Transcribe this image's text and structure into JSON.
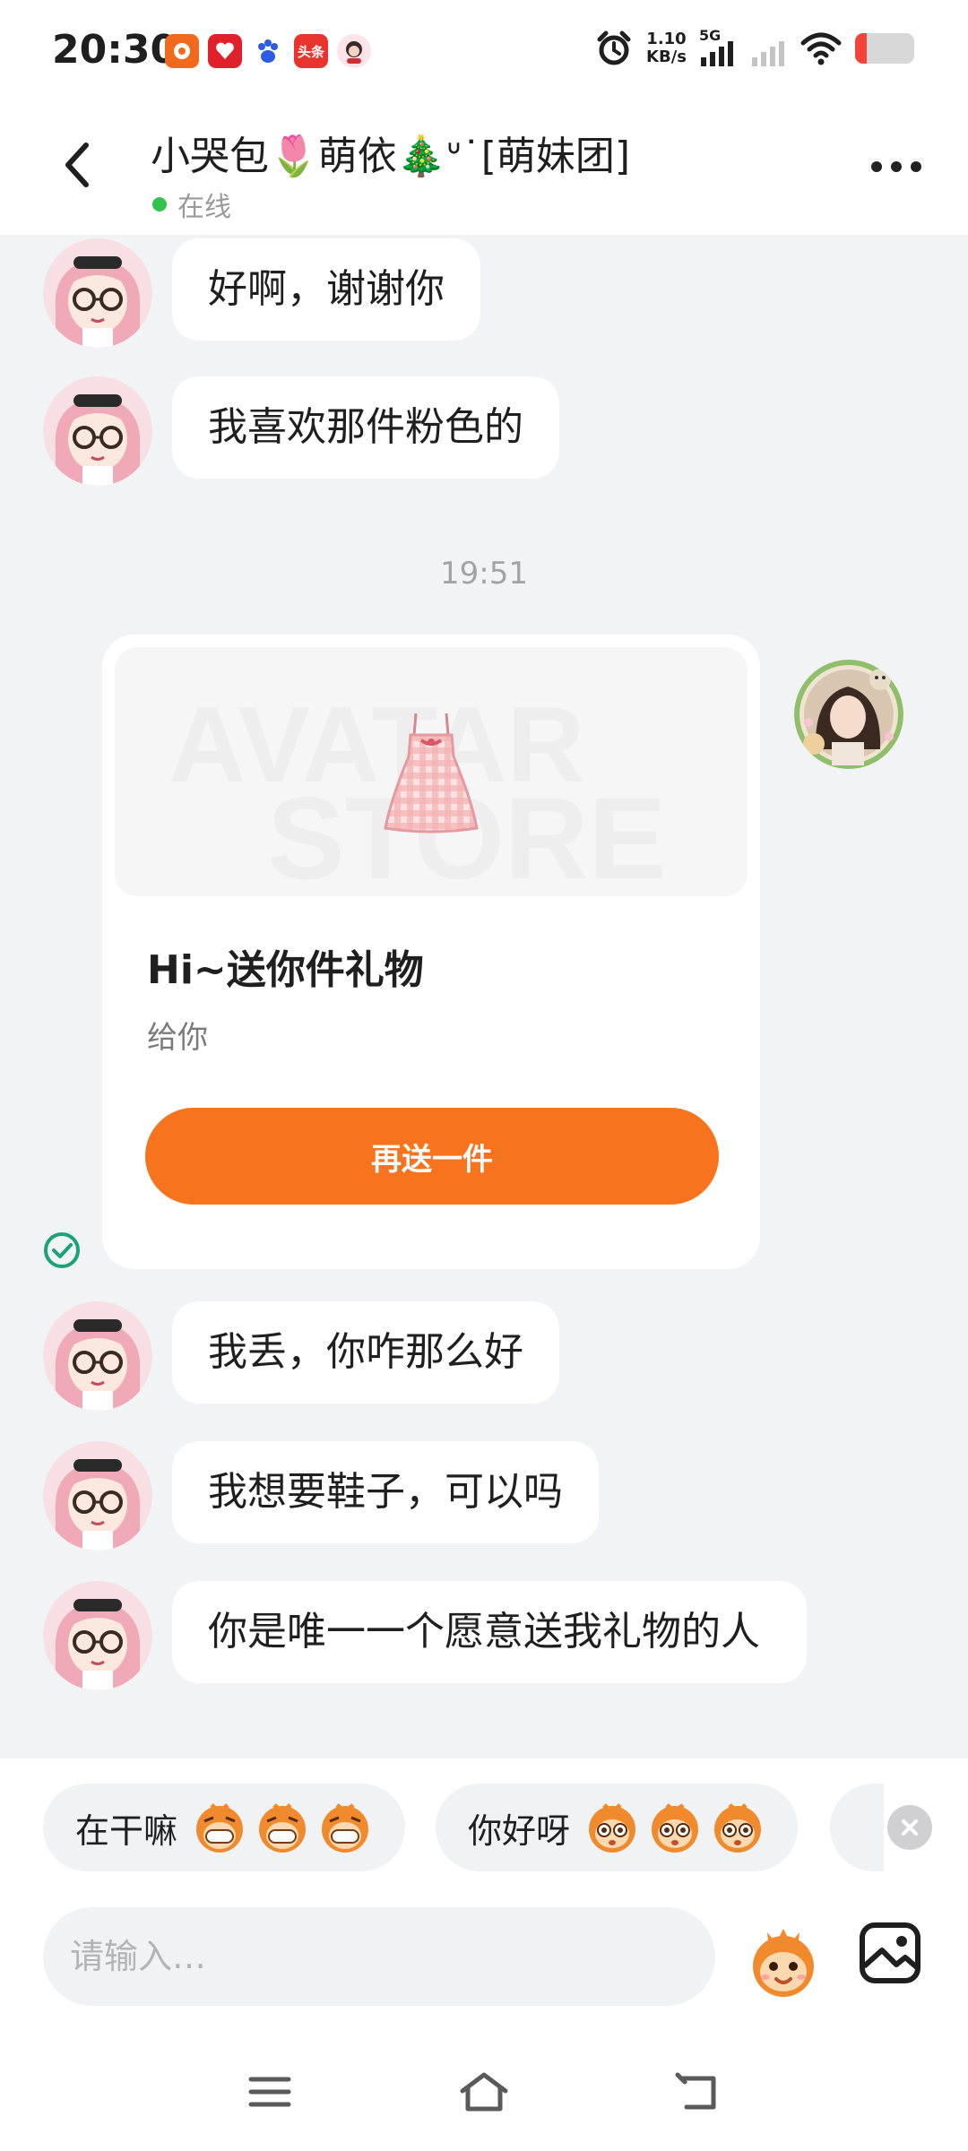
{
  "status_bar": {
    "time": "20:30",
    "app_icons": [
      "weibo-icon",
      "app-store-icon",
      "baidu-icon",
      "toutiao-icon",
      "avatar-app-icon"
    ],
    "toutiao_label": "头条",
    "net_speed_value": "1.10",
    "net_speed_unit": "KB/s",
    "network_type": "5G",
    "battery_level": 0.2
  },
  "header": {
    "title": "小哭包🌷萌依🎄ᐡ˙[萌妹团]",
    "status": "在线"
  },
  "chat": {
    "messages_top": [
      {
        "text": "好啊，谢谢你"
      },
      {
        "text": "我喜欢那件粉色的"
      }
    ],
    "time_separator": "19:51",
    "gift": {
      "watermark_top": "AVATAR",
      "watermark_bottom": "STORE",
      "title": "Hi~送你件礼物",
      "subtitle": "给你",
      "button": "再送一件"
    },
    "messages_bottom": [
      {
        "text": "我丢，你咋那么好"
      },
      {
        "text": "我想要鞋子，可以吗"
      },
      {
        "text": "你是唯一一个愿意送我礼物的人"
      }
    ]
  },
  "quick_replies": [
    {
      "label": "在干嘛"
    },
    {
      "label": "你好呀"
    }
  ],
  "input": {
    "placeholder": "请输入…"
  },
  "colors": {
    "accent_orange": "#f7731d",
    "online_green": "#32c24d",
    "check_teal": "#1aa37a",
    "background": "#f1f3f5"
  }
}
